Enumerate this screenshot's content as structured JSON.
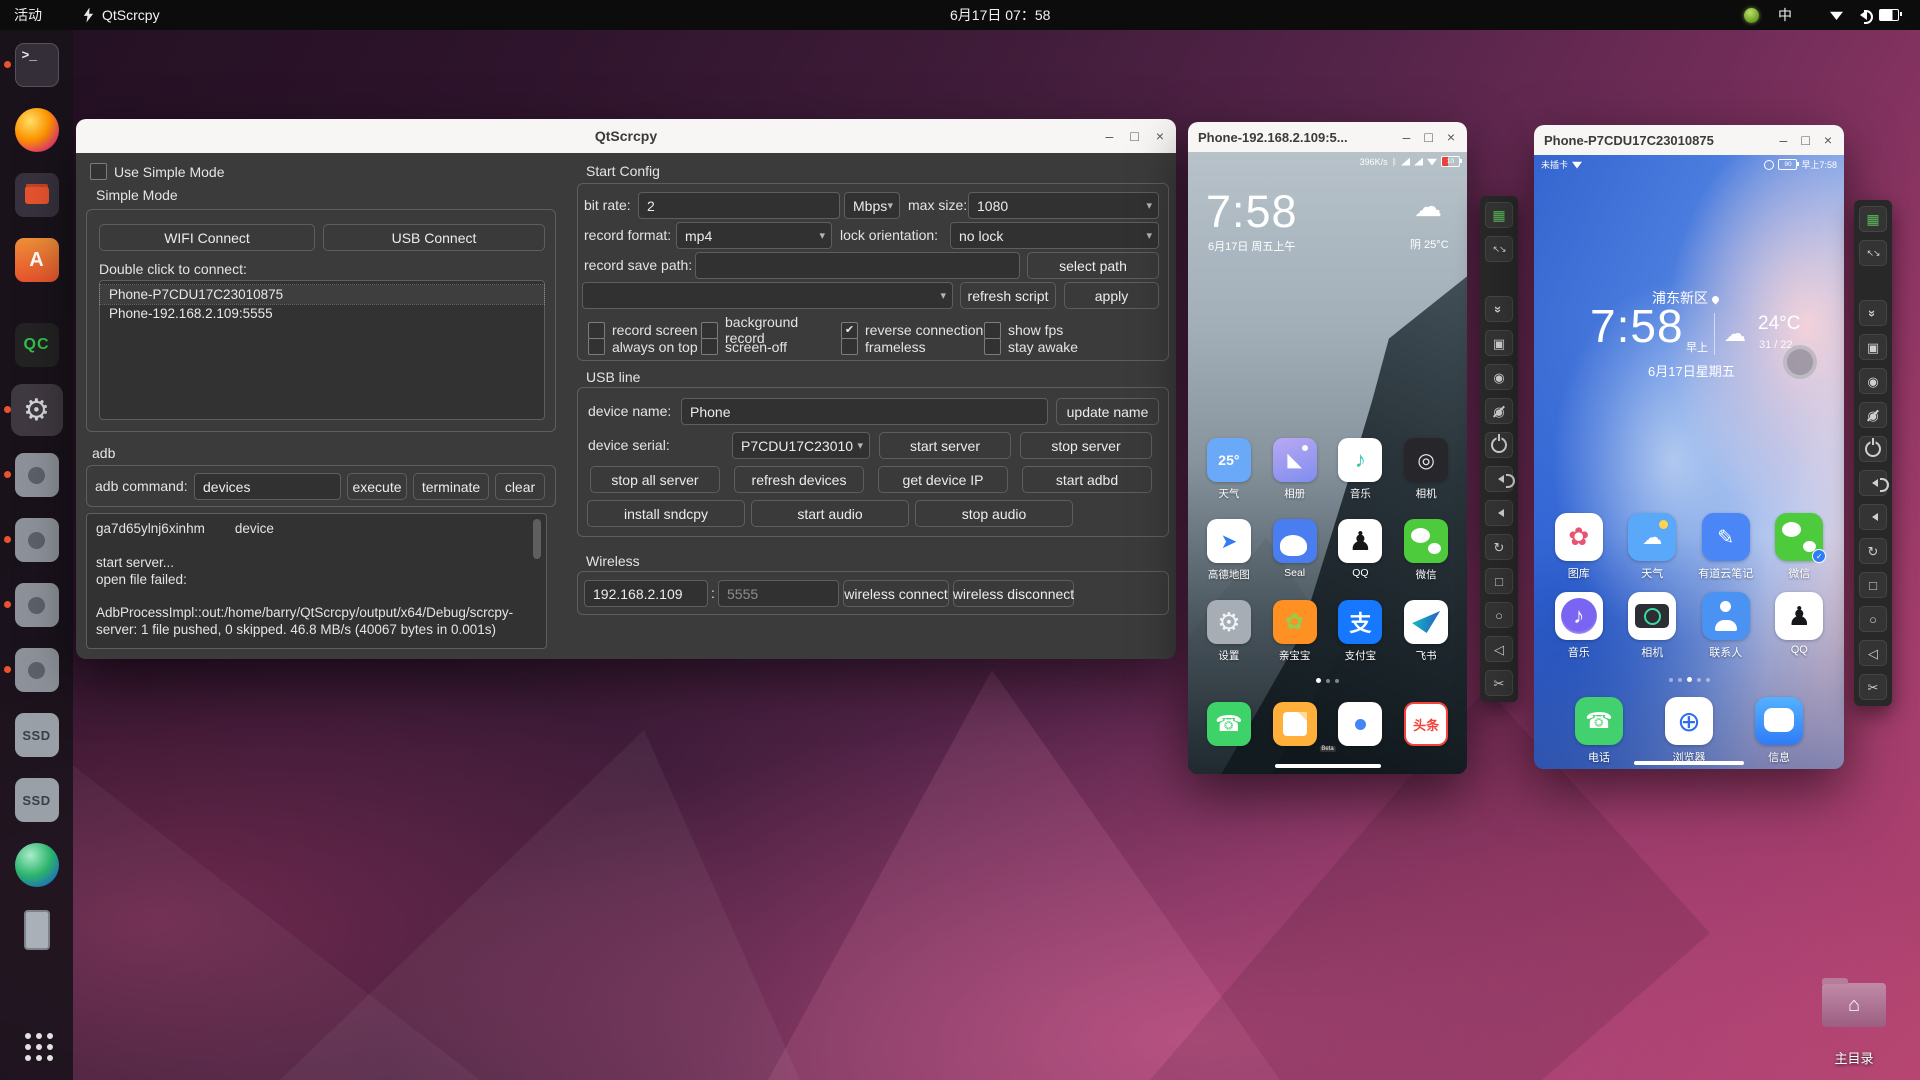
{
  "topbar": {
    "activities": "活动",
    "app_name": "QtScrcpy",
    "clock": "6月17日 07：58",
    "ime": "中"
  },
  "window_controls": {
    "minimize": "–",
    "maximize": "□",
    "close": "×"
  },
  "dock": {
    "items": [
      {
        "icon": "terminal-icon",
        "text": ">_",
        "state": "running"
      },
      {
        "icon": "firefox-icon",
        "text": "",
        "state": ""
      },
      {
        "icon": "files-icon",
        "text": "",
        "state": ""
      },
      {
        "icon": "ubuntu-software-icon",
        "text": "A",
        "state": ""
      },
      {
        "icon": "qc-icon",
        "text": "QC",
        "state": "gap"
      },
      {
        "icon": "settings-gear-icon",
        "text": "⚙",
        "state": "active running"
      },
      {
        "icon": "scrcpy-window-icon",
        "text": "",
        "state": "running"
      },
      {
        "icon": "scrcpy-window-icon",
        "text": "",
        "state": "running"
      },
      {
        "icon": "scrcpy-window-icon",
        "text": "",
        "state": "running"
      },
      {
        "icon": "scrcpy-window-icon",
        "text": "",
        "state": "running"
      },
      {
        "icon": "ssd-drive-icon",
        "text": "SSD",
        "state": ""
      },
      {
        "icon": "ssd-drive-icon",
        "text": "SSD",
        "state": ""
      },
      {
        "icon": "sphere-app-icon",
        "text": "",
        "state": ""
      },
      {
        "icon": "phone-device-icon",
        "text": "",
        "state": ""
      },
      {
        "icon": "show-apps-icon",
        "text": "",
        "state": "bottom"
      }
    ]
  },
  "main_window": {
    "title": "QtScrcpy",
    "simple_mode": {
      "use_simple_mode_label": "Use Simple Mode",
      "section_label": "Simple Mode",
      "wifi_connect_btn": "WIFI Connect",
      "usb_connect_btn": "USB Connect",
      "hint": "Double click to connect:",
      "devices": [
        {
          "name": "device-item-usb",
          "label": "Phone-P7CDU17C23010875"
        },
        {
          "name": "device-item-wifi",
          "label": "Phone-192.168.2.109:5555"
        }
      ]
    },
    "adb": {
      "section_label": "adb",
      "command_label": "adb command:",
      "command_value": "devices",
      "execute_btn": "execute",
      "terminate_btn": "terminate",
      "clear_btn": "clear",
      "log": "ga7d65ylnj6xinhm        device\n\nstart server...\nopen file failed:\n\nAdbProcessImpl::out:/home/barry/QtScrcpy/output/x64/Debug/scrcpy-server: 1 file pushed, 0 skipped. 46.8 MB/s (40067 bytes in 0.001s)"
    },
    "start_config": {
      "section_label": "Start Config",
      "bit_rate_label": "bit rate:",
      "bit_rate_value": "2",
      "bit_rate_unit": "Mbps",
      "max_size_label": "max size:",
      "max_size_value": "1080",
      "record_format_label": "record format:",
      "record_format_value": "mp4",
      "lock_orientation_label": "lock orientation:",
      "lock_orientation_value": "no lock",
      "record_save_path_label": "record save path:",
      "record_save_path_value": "",
      "select_path_btn": "select path",
      "script_value": "",
      "refresh_script_btn": "refresh script",
      "apply_btn": "apply",
      "checkboxes_row1": [
        {
          "name": "record-screen-checkbox",
          "label": "record screen",
          "mark": ""
        },
        {
          "name": "background-record-checkbox",
          "label": "background record",
          "mark": ""
        },
        {
          "name": "reverse-connection-checkbox",
          "label": "reverse connection",
          "mark": "✔"
        },
        {
          "name": "show-fps-checkbox",
          "label": "show fps",
          "mark": ""
        }
      ],
      "checkboxes_row2": [
        {
          "name": "always-on-top-checkbox",
          "label": "always on top",
          "mark": ""
        },
        {
          "name": "screen-off-checkbox",
          "label": "screen-off",
          "mark": ""
        },
        {
          "name": "frameless-checkbox",
          "label": "frameless",
          "mark": ""
        },
        {
          "name": "stay-awake-checkbox",
          "label": "stay awake",
          "mark": ""
        }
      ]
    },
    "usb_line": {
      "section_label": "USB line",
      "device_name_label": "device name:",
      "device_name_value": "Phone",
      "update_name_btn": "update name",
      "device_serial_label": "device serial:",
      "device_serial_value": "P7CDU17C23010",
      "start_server_btn": "start server",
      "stop_server_btn": "stop server",
      "row3_buttons": [
        {
          "name": "stop-all-server-button",
          "label": "stop all server"
        },
        {
          "name": "refresh-devices-button",
          "label": "refresh devices"
        },
        {
          "name": "get-device-ip-button",
          "label": "get device IP"
        },
        {
          "name": "start-adbd-button",
          "label": "start adbd"
        }
      ],
      "row4_buttons": [
        {
          "name": "install-sndcpy-button",
          "label": "install sndcpy"
        },
        {
          "name": "start-audio-button",
          "label": "start audio"
        },
        {
          "name": "stop-audio-button",
          "label": "stop audio"
        }
      ]
    },
    "wireless": {
      "section_label": "Wireless",
      "ip_value": "192.168.2.109",
      "separator": ":",
      "port_placeholder": "5555",
      "connect_btn": "wireless connect",
      "disconnect_btn": "wireless disconnect"
    }
  },
  "phone1": {
    "title": "Phone-192.168.2.109:5...",
    "status_speed": "396K/s",
    "status_bt": "ᛒ",
    "battery": "10",
    "clock": "7:58",
    "date": "6月17日 周五上午",
    "weather": "阴  25°C",
    "cloud_glyph": "☁",
    "page_dots": {
      "count": 3,
      "active_index": 0
    },
    "apps": [
      {
        "icon": "weather-icon",
        "label": "天气",
        "glyph": "25°",
        "bg": "#6aa9f7",
        "fg": "#ffffff"
      },
      {
        "icon": "gallery-icon",
        "label": "相册",
        "glyph": "◣",
        "bg": "linear-gradient(160deg,#b9a9f2,#7f8df0)",
        "fg": "#ffffff"
      },
      {
        "icon": "music-icon",
        "label": "音乐",
        "glyph": "♪",
        "bg": "#ffffff",
        "fg": "#2ec7ac"
      },
      {
        "icon": "camera-icon",
        "label": "相机",
        "glyph": "◎",
        "bg": "#26262b",
        "fg": "#e8e6f2"
      },
      {
        "icon": "amap-icon",
        "label": "高德地图",
        "glyph": "➤",
        "bg": "#ffffff",
        "fg": "#2f7cf6"
      },
      {
        "icon": "seal-icon",
        "label": "Seal",
        "glyph": "",
        "bg": "#4a7df0",
        "fg": "#ffffff"
      },
      {
        "icon": "qq-icon",
        "label": "QQ",
        "glyph": "♟",
        "bg": "#ffffff",
        "fg": "#16171b"
      },
      {
        "icon": "wechat-icon",
        "label": "微信",
        "glyph": "",
        "bg": "#4ecb3c",
        "fg": "#ffffff"
      },
      {
        "icon": "settings-icon",
        "label": "设置",
        "glyph": "⚙",
        "bg": "#a7adb5",
        "fg": "#f2f4f6"
      },
      {
        "icon": "qinbaobao-icon",
        "label": "亲宝宝",
        "glyph": "✿",
        "bg": "#ff9023",
        "fg": "#8fd14f"
      },
      {
        "icon": "alipay-icon",
        "label": "支付宝",
        "glyph": "支",
        "bg": "#1678ff",
        "fg": "#ffffff"
      },
      {
        "icon": "feishu-icon",
        "label": "飞书",
        "glyph": "",
        "bg": "#ffffff",
        "fg": "#1f6af2"
      }
    ],
    "dock": [
      {
        "icon": "phone-call-icon",
        "label": "",
        "glyph": "☎",
        "bg": "#3ed368",
        "fg": "#ffffff"
      },
      {
        "icon": "sms-icon",
        "label": "",
        "glyph": "",
        "bg": "#ffb03a",
        "fg": "#ffffff"
      },
      {
        "icon": "chrome-beta-icon",
        "label": "",
        "glyph": "",
        "sub": "Beta",
        "bg": "#ffffff",
        "fg": "#333333"
      },
      {
        "icon": "toutiao-icon",
        "label": "",
        "glyph": "头条",
        "bg": "#ffffff",
        "fg": "#f0443c"
      }
    ]
  },
  "phone2": {
    "title": "Phone-P7CDU17C23010875",
    "status_left": "未插卡",
    "battery": "90",
    "status_time": "早上7:58",
    "widget": {
      "location": "浦东新区",
      "clock": "7:58",
      "ampm": "早上",
      "temp": "24°C",
      "range": "31 / 22",
      "date": "6月17日星期五",
      "cloud_glyph": "☁"
    },
    "page_dots": {
      "count": 5,
      "active_index": 2
    },
    "apps": [
      {
        "icon": "hw-gallery-icon",
        "label": "图库",
        "glyph": "✿",
        "bg": "#ffffff",
        "fg": "#e8536f"
      },
      {
        "icon": "hw-weather-icon",
        "label": "天气",
        "glyph": "☁",
        "bg": "#5aa8fa",
        "fg": "#ffffff"
      },
      {
        "icon": "youdao-note-icon",
        "label": "有道云笔记",
        "glyph": "✎",
        "bg": "#4a86f6",
        "fg": "#ffffff"
      },
      {
        "icon": "hw-wechat-icon",
        "label": "微信",
        "glyph": "",
        "badge": "✓",
        "bg": "#4ecb3c",
        "fg": "#ffffff"
      },
      {
        "icon": "hw-music-icon",
        "label": "音乐",
        "glyph": "♪",
        "bg": "#ffffff",
        "fg": "#ffffff"
      },
      {
        "icon": "hw-camera-icon",
        "label": "相机",
        "glyph": "",
        "bg": "#ffffff",
        "fg": "#3dd9a4"
      },
      {
        "icon": "contacts-icon",
        "label": "联系人",
        "glyph": "",
        "bg": "#4b93f2",
        "fg": "#ffffff"
      },
      {
        "icon": "hw-qq-icon",
        "label": "QQ",
        "glyph": "♟",
        "bg": "#ffffff",
        "fg": "#16171b"
      }
    ],
    "dock": [
      {
        "icon": "hw-phone-icon",
        "label": "电话",
        "glyph": "☎",
        "bg": "#43d06e",
        "fg": "#ffffff"
      },
      {
        "icon": "hw-browser-icon",
        "label": "浏览器",
        "glyph": "⊕",
        "bg": "#ffffff",
        "fg": "#2f6df0"
      },
      {
        "icon": "hw-messages-icon",
        "label": "信息",
        "glyph": "",
        "bg": "linear-gradient(180deg,#55b1ff,#2f7cf6)",
        "fg": "#ffffff"
      }
    ]
  },
  "phone_toolbar": {
    "buttons": [
      {
        "icon": "group-control-icon",
        "glyph": "▦",
        "cls": "green"
      },
      {
        "icon": "fullscreen-icon",
        "glyph": "↖↘",
        "cls": "small2 gapafter"
      },
      {
        "icon": "collapse-icon",
        "glyph": "»",
        "cls": "rot90"
      },
      {
        "icon": "touch-icon",
        "glyph": "▣",
        "cls": ""
      },
      {
        "icon": "show-screen-icon",
        "glyph": "◉",
        "cls": ""
      },
      {
        "icon": "screen-off-icon",
        "glyph": "◉",
        "cls": "slash"
      },
      {
        "icon": "power-icon",
        "glyph": "",
        "cls": "power"
      },
      {
        "icon": "volume-up-icon",
        "glyph": "",
        "cls": "spk hi"
      },
      {
        "icon": "volume-down-icon",
        "glyph": "",
        "cls": "spk"
      },
      {
        "icon": "rotate-icon",
        "glyph": "↻",
        "cls": ""
      },
      {
        "icon": "app-switch-icon",
        "glyph": "□",
        "cls": ""
      },
      {
        "icon": "home-icon",
        "glyph": "○",
        "cls": ""
      },
      {
        "icon": "back-icon",
        "glyph": "◁",
        "cls": ""
      },
      {
        "icon": "screenshot-icon",
        "glyph": "✂",
        "cls": ""
      }
    ]
  },
  "desktop": {
    "home_folder_label": "主目录"
  }
}
